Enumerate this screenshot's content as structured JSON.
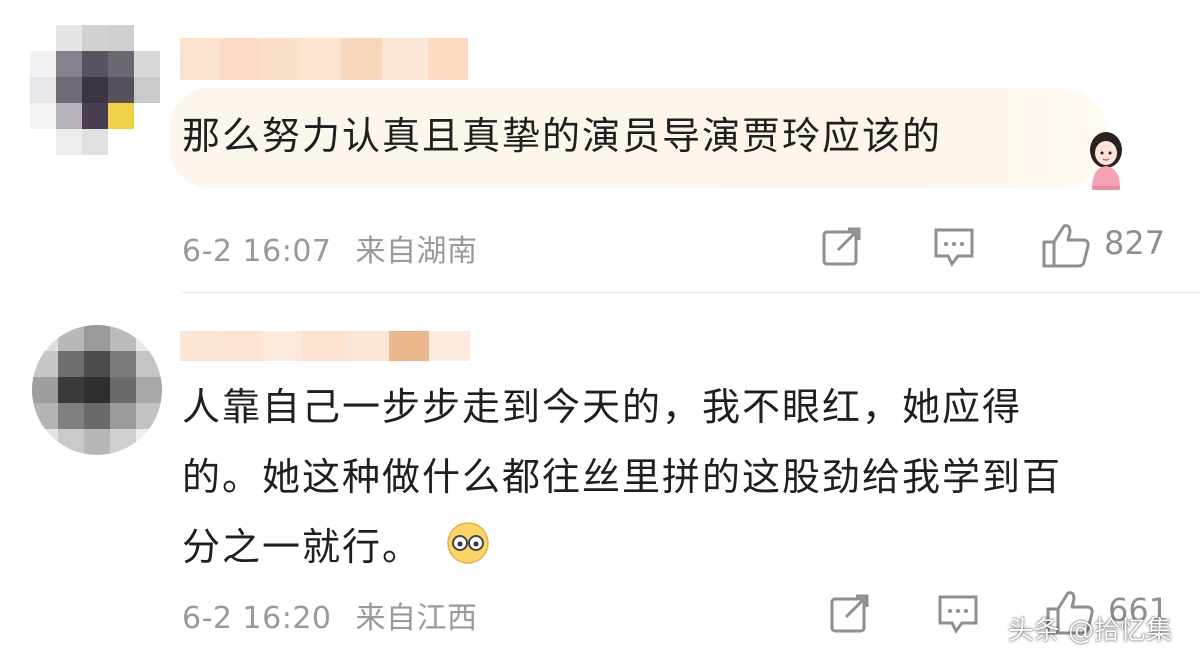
{
  "comments": [
    {
      "text": "那么努力认真且真挚的演员导演贾玲应该的",
      "time": "6-2 16:07",
      "location": "来自湖南",
      "likes": "827",
      "share_icon": "share-icon",
      "reply_icon": "comment-icon",
      "like_icon": "thumbs-up-icon"
    },
    {
      "text_line1": "人靠自己一步步走到今天的，我不眼红，她应得",
      "text_line2": "的。她这种做什么都往丝里拼的这股劲给我学到百",
      "text_line3": "分之一就行。",
      "time": "6-2 16:20",
      "location": "来自江西",
      "likes": "661",
      "share_icon": "share-icon",
      "reply_icon": "comment-icon",
      "like_icon": "thumbs-up-icon"
    }
  ],
  "watermark": "头条 @拾忆集",
  "colors": {
    "text": "#1f1f1f",
    "meta": "#9a9a9a",
    "bubble": "#fdf6ec"
  }
}
